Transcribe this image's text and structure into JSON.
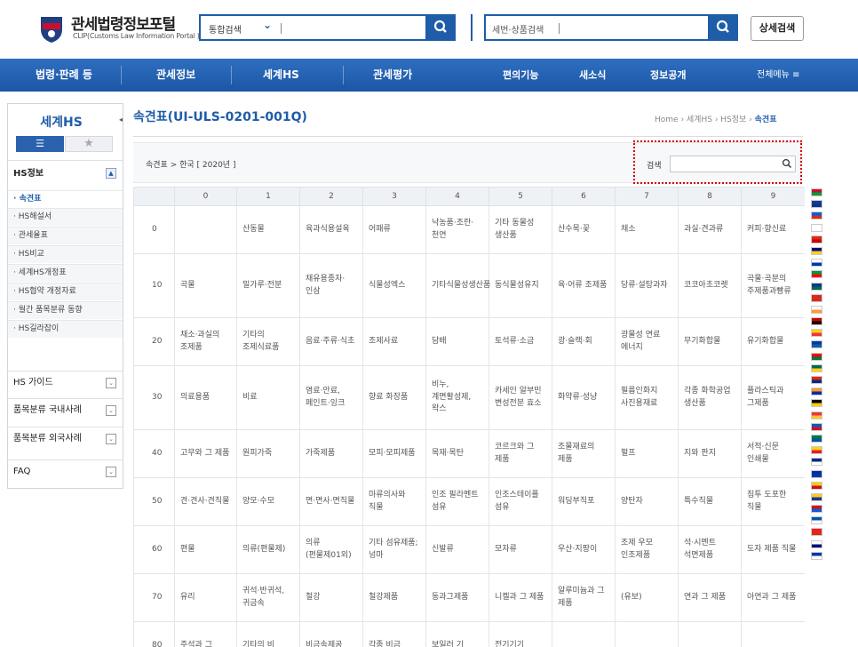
{
  "header": {
    "logo_title": "관세법령정보포털",
    "logo_subtitle": "CLIP(Customs Law Information Portal )",
    "search1_select": "통합검색",
    "search2_placeholder": "세번·상품검색",
    "advanced_search": "상세검색"
  },
  "nav": {
    "items": [
      "법령·판례 등",
      "관세정보",
      "세계HS",
      "관세평가",
      "편의기능",
      "새소식",
      "정보공개",
      "전체메뉴 ≡"
    ]
  },
  "sidebar": {
    "title": "세계HS",
    "tab_list": "☰",
    "tab_star": "★",
    "section_hs": "HS정보",
    "items": [
      "속견표",
      "HS해설서",
      "관세율표",
      "HS비교",
      "세계HS개정표",
      "HS협약 개정자료",
      "월간 품목분류 동향",
      "HS길라잡이"
    ],
    "sections": [
      "HS 가이드",
      "품목분류 국내사례",
      "품목분류 외국사례",
      "FAQ"
    ]
  },
  "page": {
    "title": "속견표(UI-ULS-0201-001Q)",
    "breadcrumb": [
      "Home",
      "세계HS",
      "HS정보",
      "속견표"
    ],
    "path": "속견표 > 한국 [ 2020년 ]",
    "search_label": "검색"
  },
  "table": {
    "headers": [
      "",
      "0",
      "1",
      "2",
      "3",
      "4",
      "5",
      "6",
      "7",
      "8",
      "9"
    ],
    "rows": [
      [
        "0",
        "",
        "산동물",
        "육과식용설육",
        "어패류",
        "낙농품·조란·천연",
        "기타 동물성 생산품",
        "산수목·꽃",
        "채소",
        "과실·견과류",
        "커피·향신료"
      ],
      [
        "10",
        "곡물",
        "밀가루·전분",
        "채유용종자·인삼",
        "식물성엑스",
        "기타식물성생산품",
        "동식물성유지",
        "육·어류 조제품",
        "당류·설탕과자",
        "코코아초코렛",
        "곡물·곡분의 주제품과빵류"
      ],
      [
        "20",
        "채소·과실의 조제품",
        "기타의 조제식료품",
        "음료·주류·식초",
        "조제사료",
        "담배",
        "토석류·소금",
        "광·슬랙·회",
        "광물성 연료 에너지",
        "무기화합물",
        "유기화합물"
      ],
      [
        "30",
        "의료용품",
        "비료",
        "염료·안료, 페인트·잉크",
        "향료 화장품",
        "비누, 계면활성제, 왁스",
        "카세인 알부민 변성전분 효소",
        "화약류·성냥",
        "필름인화지 사진용재료",
        "각종 화학공업 생산품",
        "플라스틱과 그제품"
      ],
      [
        "40",
        "고무와 그 제품",
        "원피가죽",
        "가죽제품",
        "모피·모피제품",
        "목재·목탄",
        "코르크와 그 제품",
        "조물재료의 제품",
        "펄프",
        "지와 판지",
        "서적·신문 인쇄물"
      ],
      [
        "50",
        "견·견사·견직물",
        "양모·수모",
        "면·면사·면직물",
        "마류의사와 직물",
        "인조 필라멘트 섬유",
        "인조스테이플 섬유",
        "워딩부직포",
        "양탄자",
        "특수직물",
        "침투 도포한 직물"
      ],
      [
        "60",
        "편물",
        "의류(편물제)",
        "의류(편물제01외)",
        "기타 섬유제품;넝마",
        "신발류",
        "모자류",
        "우산·지팡이",
        "조제 우모 인조제품",
        "석·시멘트 석면제품",
        "도자 제품 직물"
      ],
      [
        "70",
        "유리",
        "귀석·반귀석,귀금속",
        "철강",
        "철강제품",
        "동과그제품",
        "니켈과 그 제품",
        "알루미늄과 그 제품",
        "(유보)",
        "연과 그 제품",
        "아연과 그 제품"
      ],
      [
        "80",
        "주석과 그",
        "기타의 비",
        "비금속제공",
        "각종 비금",
        "보일러 기",
        "전기기기",
        "",
        "",
        "",
        ""
      ]
    ]
  },
  "colors": {
    "brand": "#1f5da8",
    "nav": "#2563b0",
    "highlight_border": "#d90000"
  },
  "flags": [
    "#c8102e",
    "#1a3a8f",
    "#0b5ed7",
    "#ffffff",
    "#de2910",
    "#000d7a",
    "#ffffff",
    "#009b3a",
    "#003893",
    "#d52b1e",
    "#ffffff",
    "#cc0000",
    "#fcd116",
    "#0038a8",
    "#ff0000",
    "#006a4e",
    "#da291c",
    "#ff9933",
    "#000000",
    "#ef3340",
    "#0d5eaf",
    "#007a3d",
    "#fcd116",
    "#002b7f",
    "#032ea1",
    "#ffcc00",
    "#ffc72c",
    "#ce1126",
    "#0052b4",
    "#ed1c24",
    "#ffffff",
    "#0038a8"
  ]
}
